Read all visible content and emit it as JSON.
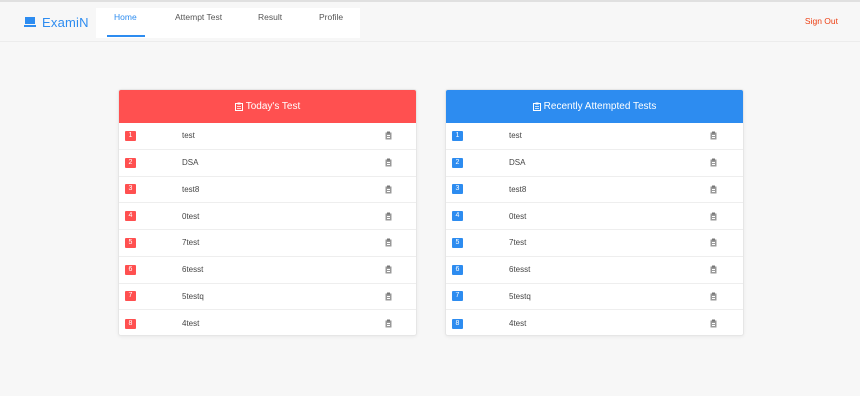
{
  "app": {
    "name": "ExamiN",
    "brand_color": "#2d8cf0"
  },
  "nav": {
    "items": [
      {
        "label": "Home",
        "active": true
      },
      {
        "label": "Attempt Test",
        "active": false
      },
      {
        "label": "Result",
        "active": false
      },
      {
        "label": "Profile",
        "active": false
      }
    ],
    "signout_label": "Sign Out",
    "signout_color": "#ed4014"
  },
  "todays_test": {
    "title": "Today's Test",
    "accent": "#ff5050",
    "icon": "clipboard-icon",
    "rows": [
      {
        "num": "1",
        "name": "test",
        "icon": "clipboard-icon"
      },
      {
        "num": "2",
        "name": "DSA",
        "icon": "clipboard-icon"
      },
      {
        "num": "3",
        "name": "test8",
        "icon": "clipboard-icon"
      },
      {
        "num": "4",
        "name": "0test",
        "icon": "clipboard-icon"
      },
      {
        "num": "5",
        "name": "7test",
        "icon": "clipboard-icon"
      },
      {
        "num": "6",
        "name": "6tesst",
        "icon": "clipboard-icon"
      },
      {
        "num": "7",
        "name": "5testq",
        "icon": "clipboard-icon"
      },
      {
        "num": "8",
        "name": "4test",
        "icon": "clipboard-icon"
      }
    ]
  },
  "recent_tests": {
    "title": "Recently Attempted Tests",
    "accent": "#2d8cf0",
    "icon": "clipboard-icon",
    "rows": [
      {
        "num": "1",
        "name": "test",
        "icon": "clipboard-icon"
      },
      {
        "num": "2",
        "name": "DSA",
        "icon": "clipboard-icon"
      },
      {
        "num": "3",
        "name": "test8",
        "icon": "clipboard-icon"
      },
      {
        "num": "4",
        "name": "0test",
        "icon": "clipboard-icon"
      },
      {
        "num": "5",
        "name": "7test",
        "icon": "clipboard-icon"
      },
      {
        "num": "6",
        "name": "6tesst",
        "icon": "clipboard-icon"
      },
      {
        "num": "7",
        "name": "5testq",
        "icon": "clipboard-icon"
      },
      {
        "num": "8",
        "name": "4test",
        "icon": "clipboard-icon"
      }
    ]
  }
}
